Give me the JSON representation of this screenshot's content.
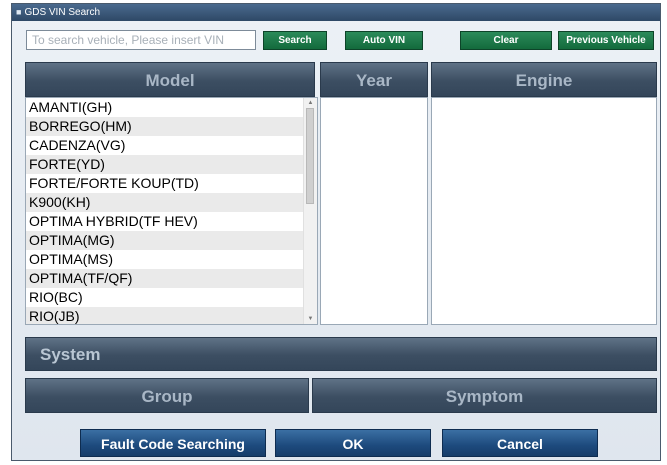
{
  "window": {
    "title": "GDS VIN Search"
  },
  "search": {
    "placeholder": "To search vehicle, Please insert VIN",
    "search_label": "Search",
    "auto_vin_label": "Auto VIN",
    "clear_label": "Clear",
    "previous_vehicle_label": "Previous Vehicle"
  },
  "columns": {
    "model": "Model",
    "year": "Year",
    "engine": "Engine"
  },
  "models": [
    "AMANTI(GH)",
    "BORREGO(HM)",
    "CADENZA(VG)",
    "FORTE(YD)",
    "FORTE/FORTE KOUP(TD)",
    "K900(KH)",
    "OPTIMA HYBRID(TF HEV)",
    "OPTIMA(MG)",
    "OPTIMA(MS)",
    "OPTIMA(TF/QF)",
    "RIO(BC)",
    "RIO(JB)"
  ],
  "sections": {
    "system": "System",
    "group": "Group",
    "symptom": "Symptom"
  },
  "footer": {
    "fault_code_label": "Fault Code Searching",
    "ok_label": "OK",
    "cancel_label": "Cancel"
  },
  "colors": {
    "header": "#3c4e62",
    "green_button": "#1f7a48",
    "blue_button": "#1d4a7d"
  },
  "icons": {
    "title": "window-icon",
    "scroll_up": "arrow-up-icon",
    "scroll_down": "arrow-down-icon"
  }
}
